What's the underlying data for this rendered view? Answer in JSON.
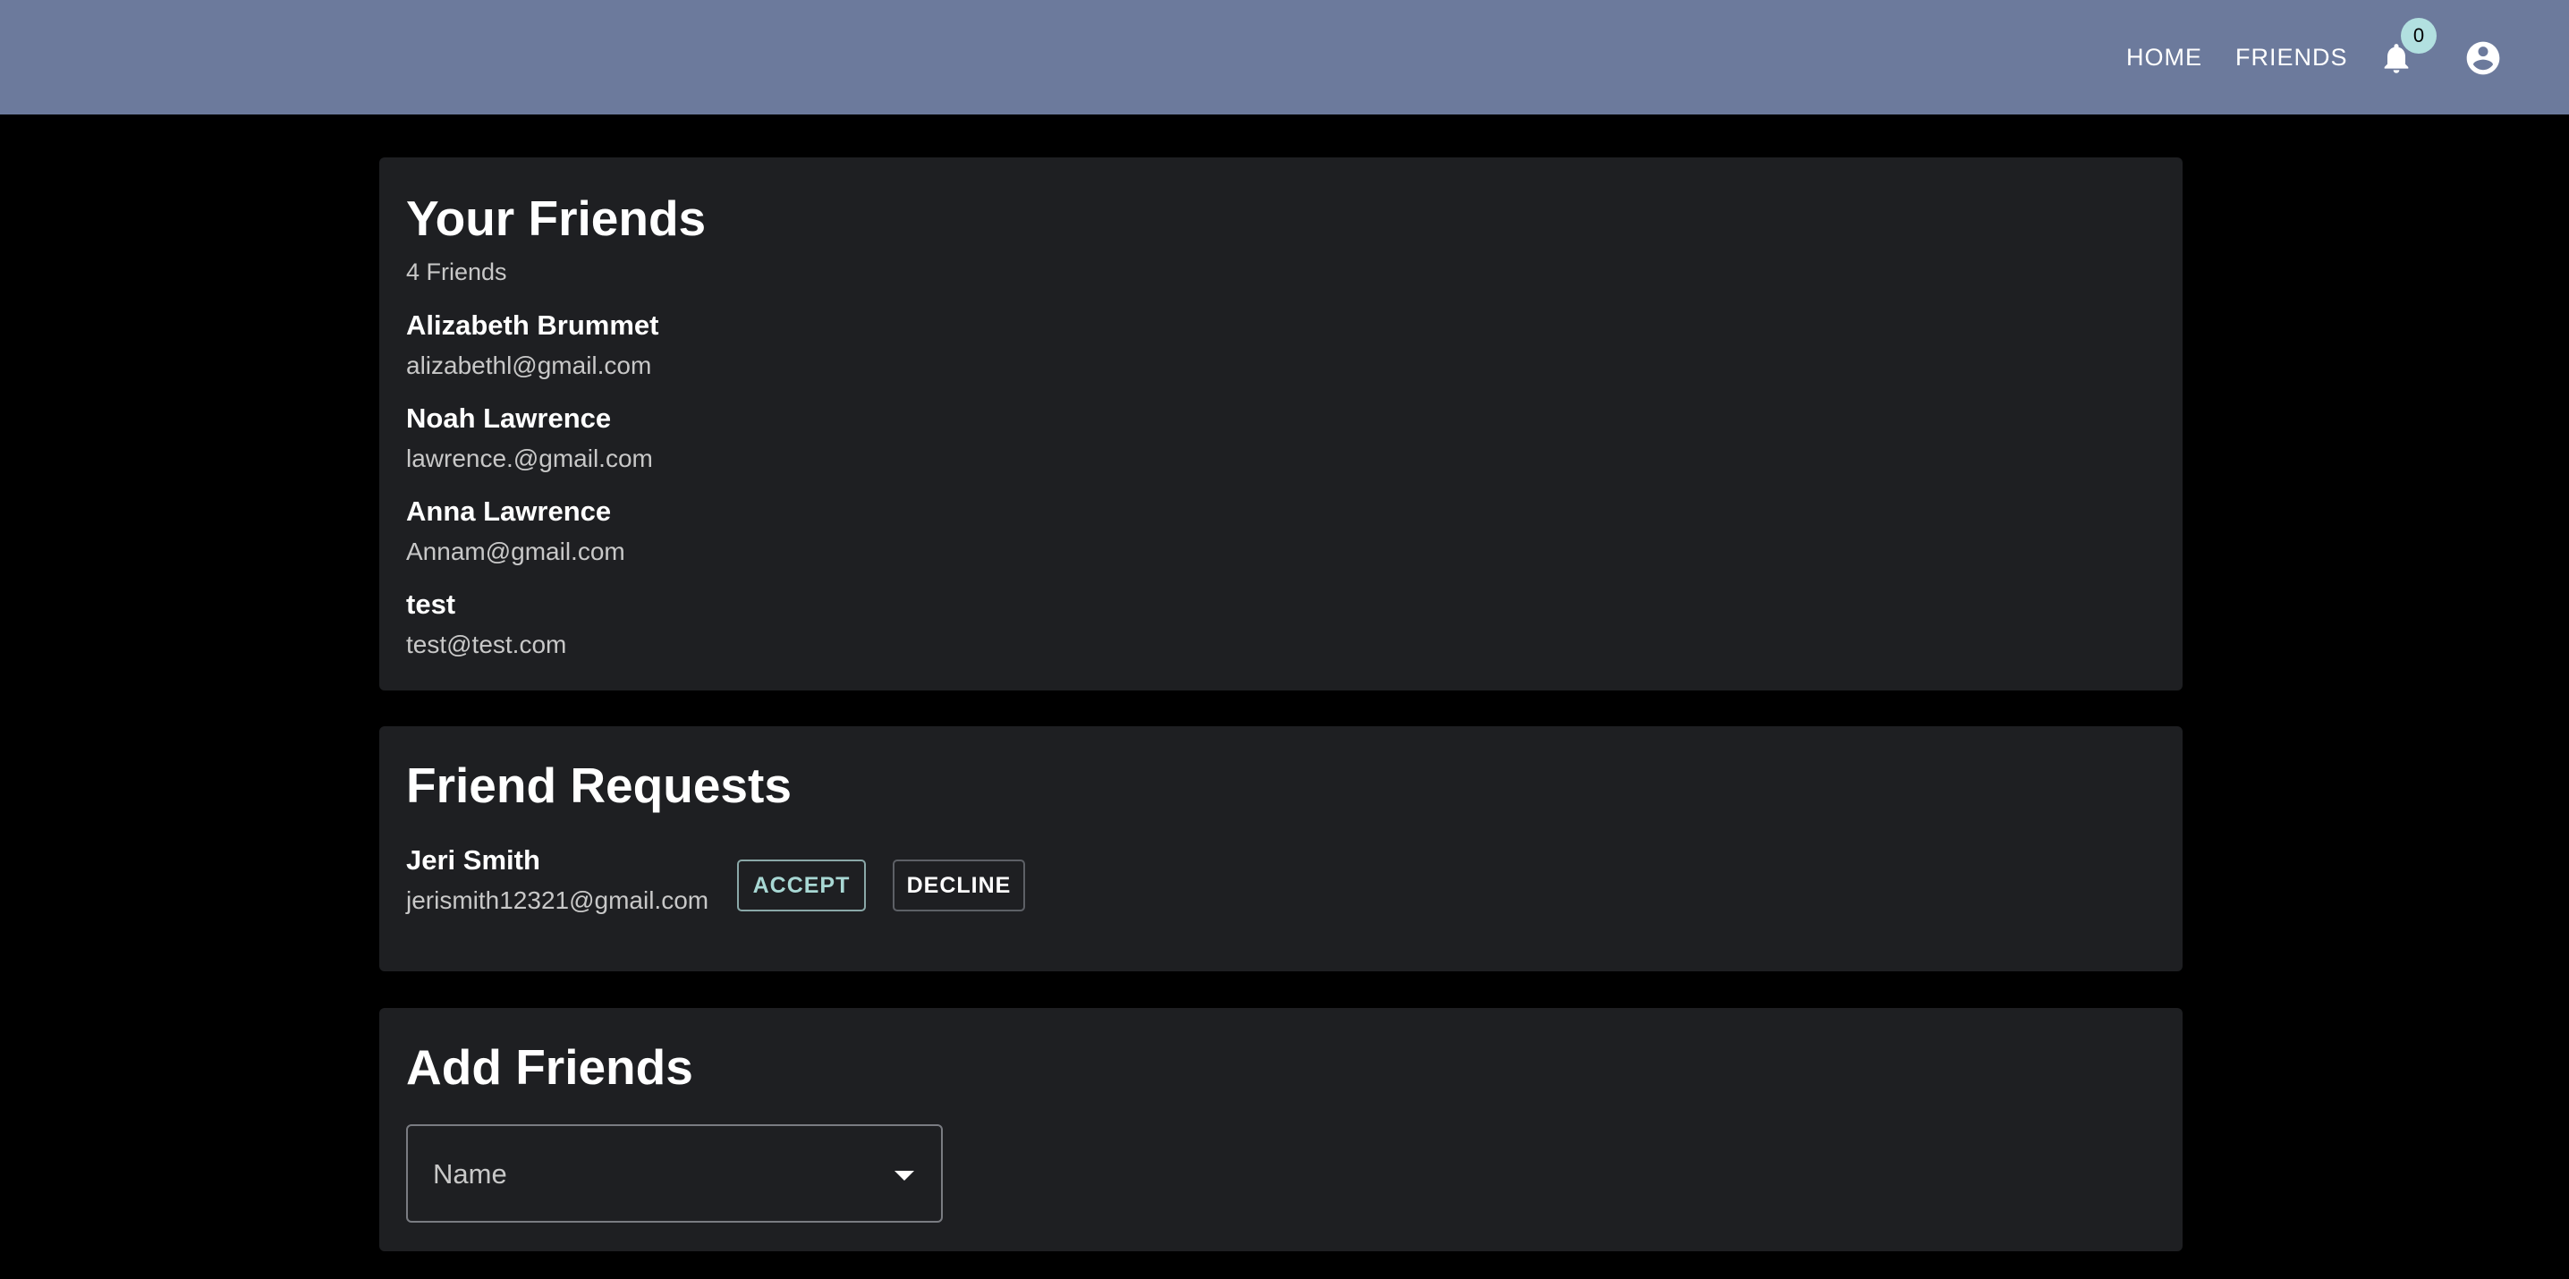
{
  "appbar": {
    "nav": [
      {
        "label": "HOME"
      },
      {
        "label": "FRIENDS"
      }
    ],
    "notifications": {
      "icon": "bell-icon",
      "count": "0"
    },
    "account": {
      "icon": "account-circle-icon"
    },
    "color": "#6c7a9c"
  },
  "friends_section": {
    "title": "Your Friends",
    "count_label": "4 Friends",
    "friends": [
      {
        "name": "Alizabeth Brummet",
        "email": "alizabethl@gmail.com"
      },
      {
        "name": "Noah Lawrence",
        "email": "lawrence.@gmail.com"
      },
      {
        "name": "Anna Lawrence",
        "email": "Annam@gmail.com"
      },
      {
        "name": "test",
        "email": "test@test.com"
      }
    ]
  },
  "requests_section": {
    "title": "Friend Requests",
    "requests": [
      {
        "name": "Jeri Smith",
        "email": "jerismith12321@gmail.com",
        "accept_label": "ACCEPT",
        "decline_label": "DECLINE"
      }
    ]
  },
  "add_section": {
    "title": "Add Friends",
    "select": {
      "label": "Name",
      "icon": "chevron-down-icon"
    }
  },
  "colors": {
    "background": "#000000",
    "card": "#1e1f22",
    "accent": "#a8d8d4",
    "badge": "#b2e0e0"
  }
}
